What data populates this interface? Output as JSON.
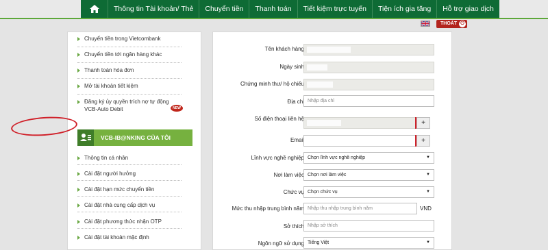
{
  "nav": {
    "home_icon": "home-icon",
    "items": [
      "Thông tin Tài khoản/ Thẻ",
      "Chuyển tiền",
      "Thanh toán",
      "Tiết kiệm trực tuyến",
      "Tiện ích gia tăng",
      "Hỗ trợ giao dịch"
    ]
  },
  "header": {
    "logout_label": "THOÁT",
    "language_icon": "uk-flag-icon"
  },
  "sidebar": {
    "top_items": [
      "Chuyển tiền trong Vietcombank",
      "Chuyển tiền tới ngân hàng khác",
      "Thanh toán hóa đơn",
      "Mở tài khoản tiết kiệm",
      "Đăng ký ủy quyền trích nợ tự động VCB-Auto Debit"
    ],
    "new_badge": "NEW",
    "section_title": "VCB-IB@NKING CỦA TÔI",
    "section_items": [
      "Thông tin cá nhân",
      "Cài đặt người hưởng",
      "Cài đặt hạn mức chuyển tiền",
      "Cài đặt nhà cung cấp dịch vụ",
      "Cài đặt phương thức nhận OTP",
      "Cài đặt tài khoản mặc định"
    ]
  },
  "form": {
    "customer_name_label": "Tên khách hàng",
    "dob_label": "Ngày sinh",
    "id_label": "Chứng minh thư/ hộ chiếu",
    "address_label": "Địa chỉ",
    "address_placeholder": "Nhập địa chỉ",
    "phone_label": "Số điện thoại liên hệ",
    "email_label": "Email",
    "field_label": "Lĩnh vực nghề nghiệp",
    "field_value": "Chọn lĩnh vực nghề nghiệp",
    "workplace_label": "Nơi làm việc",
    "workplace_value": "Chọn nơi làm việc",
    "position_label": "Chức vụ",
    "position_value": "Chọn chức vụ",
    "income_label": "Mức thu nhập trung bình năm",
    "income_placeholder": "Nhập thu nhập trung bình năm",
    "income_unit": "VND",
    "hobby_label": "Sở thích",
    "hobby_placeholder": "Nhập sở thích",
    "language_label": "Ngôn ngữ sử dụng",
    "language_value": "Tiếng Việt",
    "plus": "+",
    "arrow": "▼"
  },
  "colors": {
    "nav_green": "#0e6b35",
    "accent_green": "#76b13f",
    "highlight_red": "#d0212a"
  }
}
